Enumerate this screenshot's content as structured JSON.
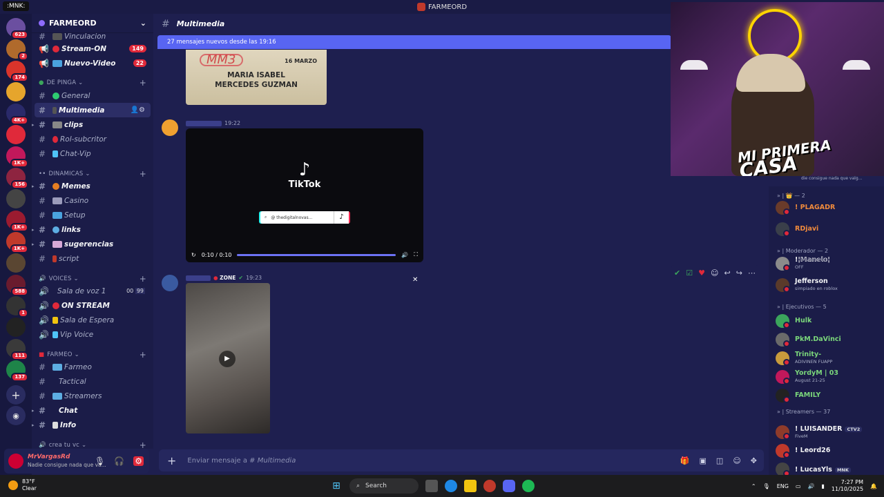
{
  "titlebar": {
    "app_name": "FARMEORD",
    "mnk": ":MNK:"
  },
  "rail": {
    "servers": [
      {
        "badge": "623",
        "color": "#6b4fa0"
      },
      {
        "badge": "2",
        "color": "#b06a2c"
      },
      {
        "badge": "174",
        "color": "#d9342b"
      },
      {
        "badge": "",
        "color": "#e6a52c"
      },
      {
        "badge": "4K+",
        "color": "#2a2a6a"
      },
      {
        "badge": "",
        "color": "#e0293a"
      },
      {
        "badge": "1K+",
        "color": "#c2185b"
      },
      {
        "badge": "156",
        "color": "#8e2440"
      },
      {
        "badge": "",
        "color": "#444"
      },
      {
        "badge": "1K+",
        "color": "#9b1b30"
      },
      {
        "badge": "1K+",
        "color": "#c0392b"
      },
      {
        "badge": "",
        "color": "#5a4632"
      },
      {
        "badge": "588",
        "color": "#6a1b2e"
      },
      {
        "badge": "1",
        "color": "#333"
      },
      {
        "badge": "",
        "color": "#222"
      },
      {
        "badge": "111",
        "color": "#3a3a3a"
      },
      {
        "badge": "137",
        "color": "#1e8449"
      }
    ]
  },
  "sidebar": {
    "guild_name": "FARMEORD",
    "top_channels": [
      {
        "label": "Vinculacion",
        "badge": ""
      },
      {
        "label": "Stream-ON",
        "badge": "149"
      },
      {
        "label": "Nuevo-Video",
        "badge": "22"
      }
    ],
    "categories": {
      "de_pinga": "DE PINGA",
      "dinamicas": "DINAMICAS",
      "voices": "VOICES",
      "farmeo": "FARMEO",
      "crea_tu_vc": "crea tu vc"
    },
    "de_pinga_channels": [
      {
        "label": "General"
      },
      {
        "label": "Multimedia"
      },
      {
        "label": "clips"
      },
      {
        "label": "Rol-subcritor"
      },
      {
        "label": "Chat-Vip"
      }
    ],
    "dinamicas_channels": [
      {
        "label": "Memes"
      },
      {
        "label": "Casino"
      },
      {
        "label": "Setup"
      },
      {
        "label": "links"
      },
      {
        "label": "sugerencias"
      },
      {
        "label": "script"
      }
    ],
    "voice_channels": [
      {
        "label": "Sala de voz 1",
        "n1": "00",
        "n2": "99"
      },
      {
        "label": "ON STREAM"
      },
      {
        "label": "Sala de Espera"
      },
      {
        "label": "Vip Voice"
      }
    ],
    "farmeo_channels": [
      {
        "label": "Farmeo"
      },
      {
        "label": "Tactical"
      },
      {
        "label": "Streamers"
      },
      {
        "label": "Chat"
      },
      {
        "label": "Info"
      }
    ]
  },
  "user": {
    "name": "MrVargasRd",
    "status": "Nadie consigue nada que va..."
  },
  "chat": {
    "channel_name": "Multimedia",
    "new_messages": "27 mensajes nuevos desde las 19:16",
    "image_card": {
      "line1": "MARIA ISABEL",
      "line2": "MERCEDES GUZMAN",
      "date": "16 MARZO",
      "mm": "MM3"
    },
    "msg1_time": "19:22",
    "video": {
      "brand": "TikTok",
      "handle": "@ thedigitalnovas...",
      "time": "0:10 / 0:10"
    },
    "msg2_zone": "ZONE",
    "msg2_time": "19:23",
    "composer_placeholder": "Enviar mensaje a #",
    "composer_channel": "Multimedia"
  },
  "webcam": {
    "overlay_text_1": "MI PRIMERA",
    "overlay_text_2": "CASA",
    "sub": "die consigue nada que valg..."
  },
  "members": {
    "group_1": "2",
    "group_moderador": "Moderador — 2",
    "group_ejecutivos": "Ejecutivos — 5",
    "group_streamers": "Streamers — 37",
    "list": [
      {
        "name": "! PLAGADR",
        "sub": "",
        "color": "#f08a3c",
        "av": "#6a3b2a"
      },
      {
        "name": "RDjavi",
        "sub": "",
        "color": "#f08a3c",
        "av": "#3a3f4a"
      },
      {
        "name": "!¦𝕄𝕒𝕟𝕖𝕝𝕠¦",
        "sub": "OFF",
        "color": "#f2f3f5",
        "av": "#8b8b8b"
      },
      {
        "name": "Jefferson",
        "sub": "simpiado en roblox",
        "color": "#f2f3f5",
        "av": "#5a3a2a"
      },
      {
        "name": "Hulk",
        "sub": "",
        "color": "#7bd77b",
        "av": "#3ba55c"
      },
      {
        "name": "PkM.DaVinci",
        "sub": "",
        "color": "#7bd77b",
        "av": "#6a6a6a"
      },
      {
        "name": "Trinity-",
        "sub": "ADIVINEN FUAPP",
        "color": "#7bd77b",
        "av": "#c89b3c"
      },
      {
        "name": "YordyM | 03",
        "sub": "August 21-25",
        "color": "#7bd77b",
        "av": "#c2185b"
      },
      {
        "name": "FAMILY",
        "sub": "",
        "color": "#7bd77b",
        "av": "#222"
      },
      {
        "name": "! LUISANDER",
        "sub": "FiveM",
        "color": "#f2f3f5",
        "tag": "CTV2",
        "av": "#8e3b2a"
      },
      {
        "name": "! Leord26",
        "sub": "",
        "color": "#f2f3f5",
        "av": "#c0392b"
      },
      {
        "name": "! LucasYls",
        "sub": "",
        "color": "#f2f3f5",
        "tag": "MNK",
        "av": "#444"
      }
    ]
  },
  "taskbar": {
    "temp": "83°F",
    "weather": "Clear",
    "search": "Search",
    "lang": "ENG",
    "time": "7:27 PM",
    "date": "11/10/2025"
  },
  "colors": {
    "accent": "#5865f2",
    "mention_badge": "#e0293a"
  }
}
